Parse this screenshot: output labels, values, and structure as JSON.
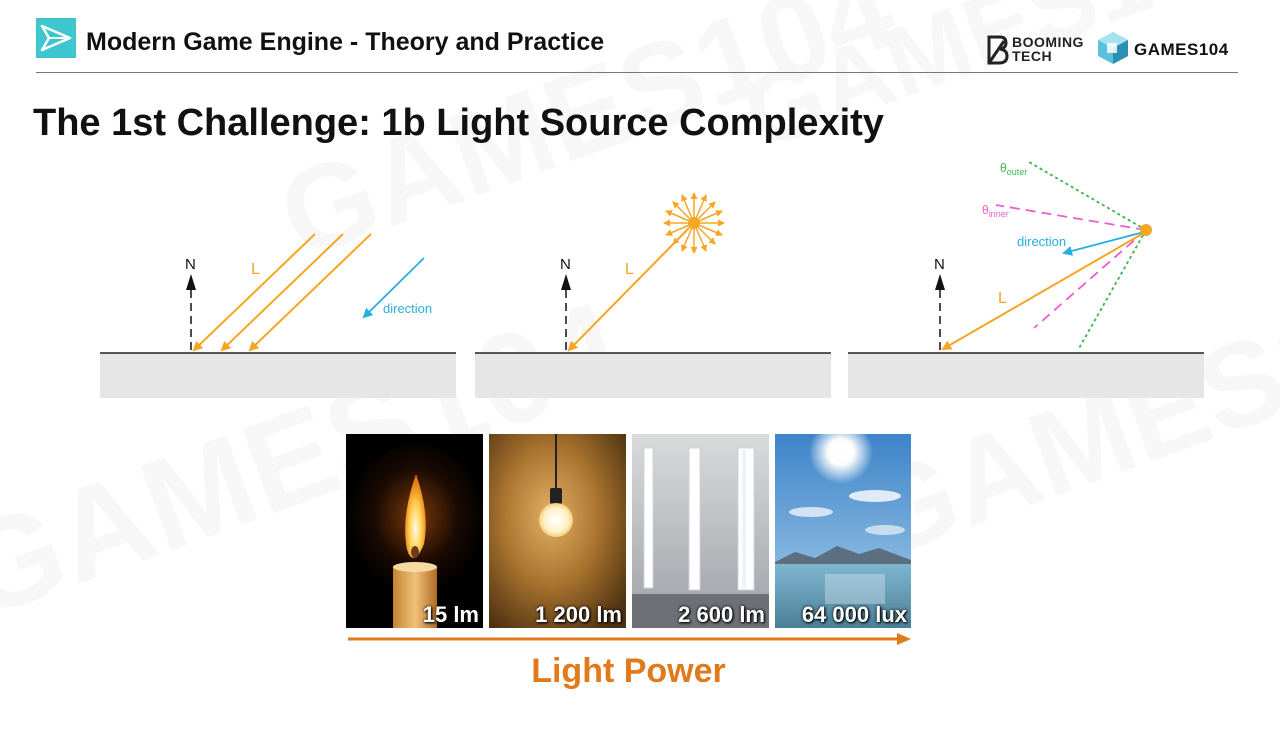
{
  "header": {
    "title": "Modern Game Engine - Theory and Practice",
    "booming_logo_text_1": "BOOMING",
    "booming_logo_text_2": "TECH",
    "games_logo_text": "GAMES104"
  },
  "slide_title": "The 1st Challenge: 1b Light Source Complexity",
  "diagrams": {
    "directional": {
      "normal_label": "N",
      "light_label": "L",
      "direction_label": "direction"
    },
    "point": {
      "normal_label": "N",
      "light_label": "L"
    },
    "spot": {
      "normal_label": "N",
      "light_label": "L",
      "direction_label": "direction",
      "outer_angle_symbol": "θ",
      "outer_angle_sub": "outer",
      "inner_angle_symbol": "θ",
      "inner_angle_sub": "inner"
    }
  },
  "photos": [
    {
      "label": "15 lm",
      "icon": "candle"
    },
    {
      "label": "1 200 lm",
      "icon": "light-bulb"
    },
    {
      "label": "2 600 lm",
      "icon": "fluorescent-tubes"
    },
    {
      "label": "64 000 lux",
      "icon": "sun-over-sea"
    }
  ],
  "power_label": "Light Power",
  "colors": {
    "light_ray": "#f5a623",
    "direction": "#29aee0",
    "outer_cone": "#3ab54a",
    "inner_cone": "#ee5ccd",
    "power": "#e07a1a",
    "ground": "#e6e6e6"
  }
}
